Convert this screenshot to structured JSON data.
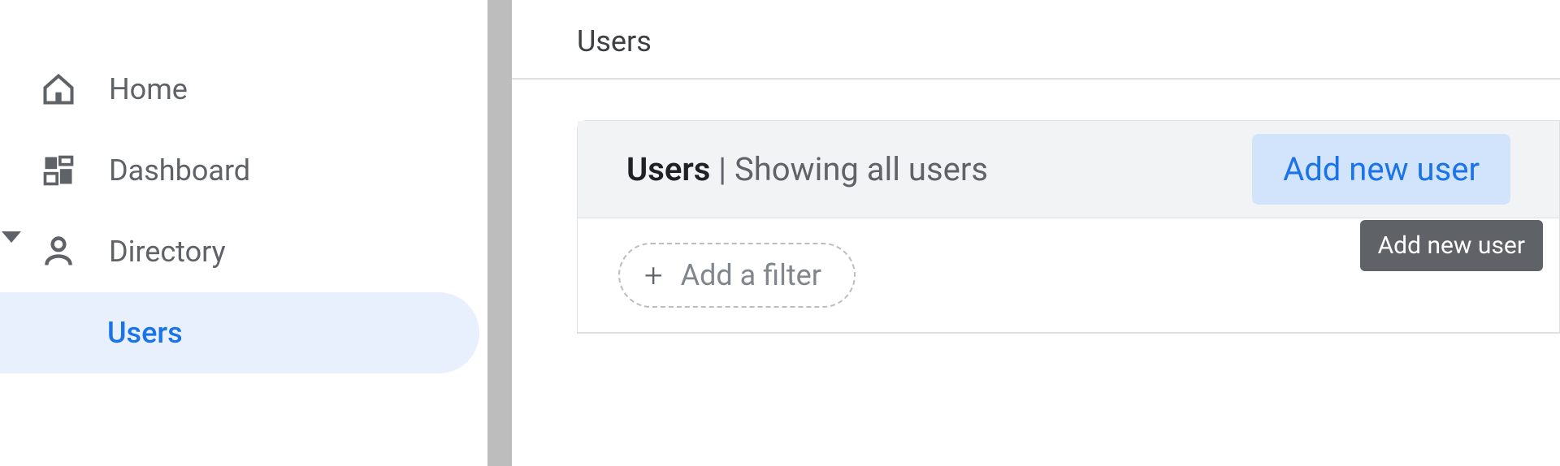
{
  "sidebar": {
    "items": [
      {
        "label": "Home"
      },
      {
        "label": "Dashboard"
      },
      {
        "label": "Directory"
      },
      {
        "label": "Users"
      }
    ]
  },
  "main": {
    "page_title": "Users",
    "card": {
      "title_strong": "Users",
      "title_divider": " | ",
      "title_rest": "Showing all users",
      "add_user_label": "Add new user",
      "tooltip": "Add new user",
      "filter_label": "Add a filter"
    }
  }
}
